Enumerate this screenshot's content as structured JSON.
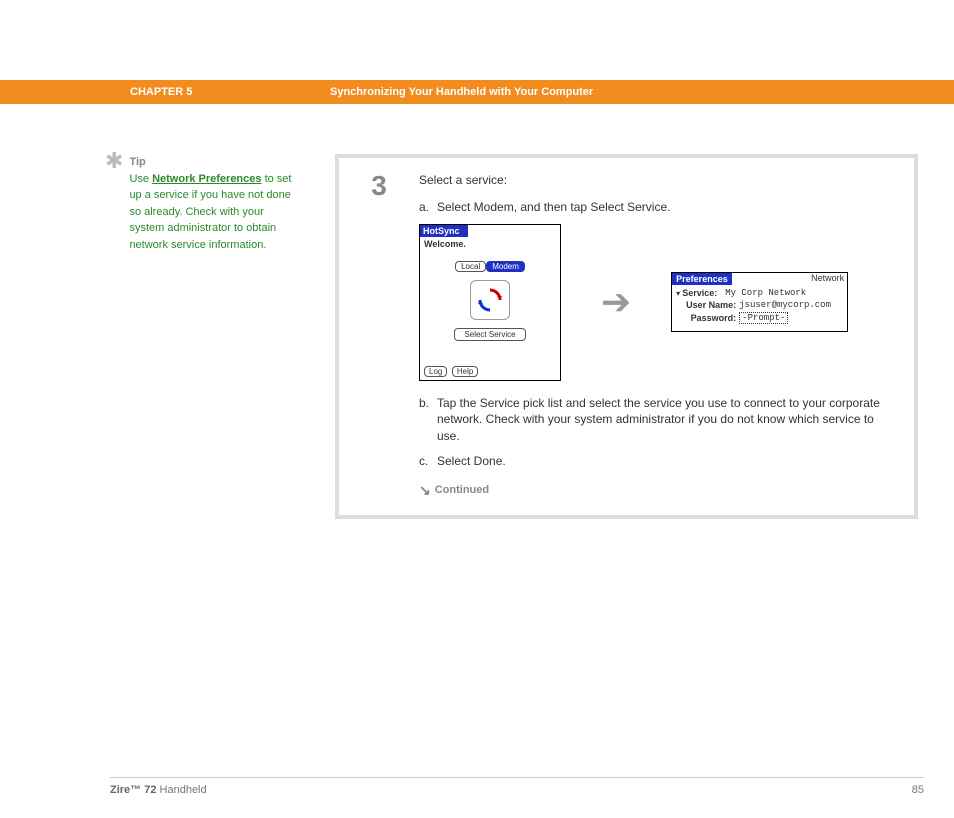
{
  "header": {
    "chapter": "CHAPTER 5",
    "title": "Synchronizing Your Handheld with Your Computer"
  },
  "tip": {
    "label": "Tip",
    "prefix": "Use ",
    "link": "Network Preferences",
    "rest": " to set up a service if you have not done so already. Check with your system administrator to obtain network service information."
  },
  "step": {
    "number": "3",
    "intro": "Select a service:",
    "a_letter": "a.",
    "a_text": "Select Modem, and then tap Select Service.",
    "b_letter": "b.",
    "b_text": "Tap the Service pick list and select the service you use to connect to your corporate network. Check with your system administrator if you do not know which service to use.",
    "c_letter": "c.",
    "c_text": "Select Done.",
    "continued": "Continued"
  },
  "hotsync": {
    "title": "HotSync",
    "welcome": "Welcome.",
    "tab_local": "Local",
    "tab_modem": "Modem",
    "select_service": "Select Service",
    "log": "Log",
    "help": "Help"
  },
  "prefs": {
    "title": "Preferences",
    "category": "Network",
    "service_label": "Service:",
    "service_value": "My Corp Network",
    "username_label": "User Name:",
    "username_value": "jsuser@mycorp.com",
    "password_label": "Password:",
    "password_value": "-Prompt-"
  },
  "footer": {
    "product_bold": "Zire™ 72",
    "product_rest": " Handheld",
    "page": "85"
  }
}
